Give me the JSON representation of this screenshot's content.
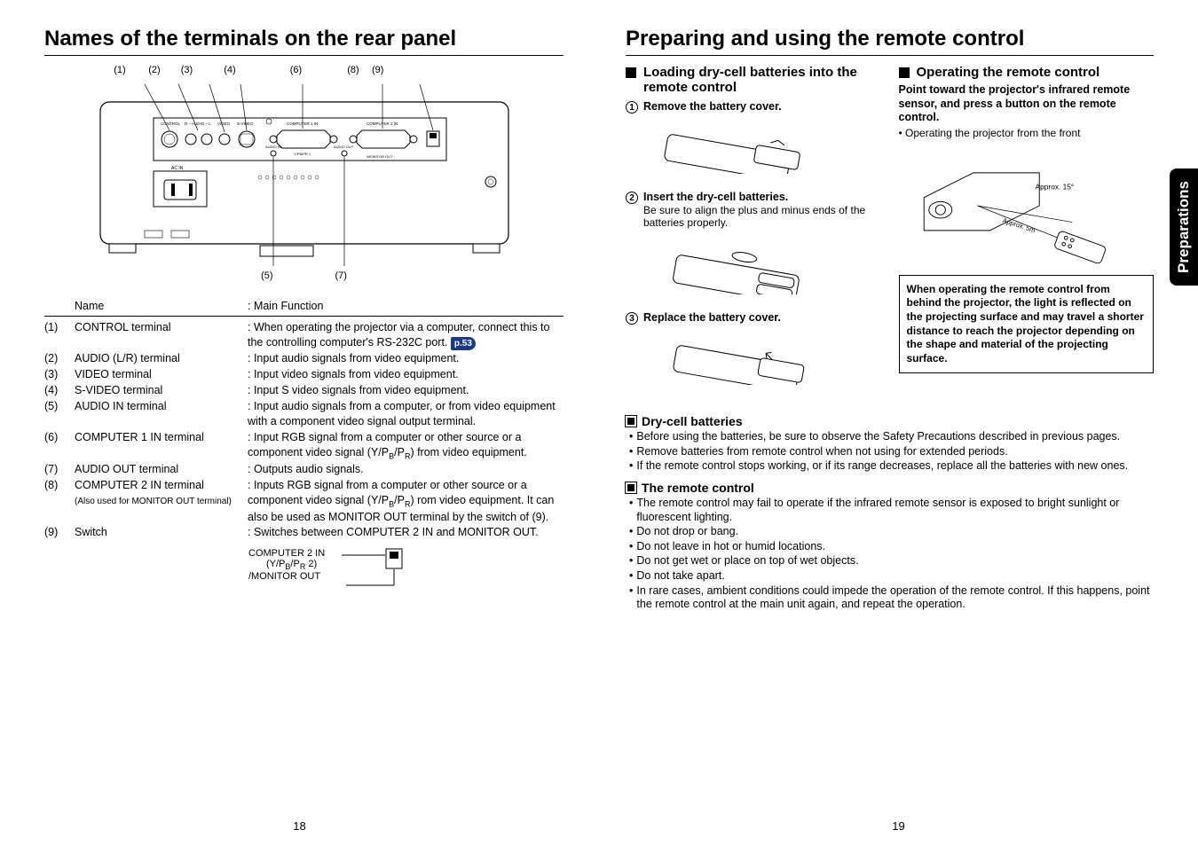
{
  "left": {
    "title": "Names of the terminals on the rear panel",
    "callouts_top": [
      "(1)",
      "(2)",
      "(3)",
      "(4)",
      "(6)",
      "(8)",
      "(9)"
    ],
    "callouts_bottom": [
      "(5)",
      "(7)"
    ],
    "table_head": {
      "name": "Name",
      "func": ": Main Function"
    },
    "rows": [
      {
        "n": "(1)",
        "name": "CONTROL terminal",
        "func": ": When operating the projector via a computer, connect this to the controlling computer's RS-232C port.",
        "pref": "p.53"
      },
      {
        "n": "(2)",
        "name": "AUDIO (L/R) terminal",
        "func": ": Input audio signals from video equipment."
      },
      {
        "n": "(3)",
        "name": "VIDEO terminal",
        "func": ": Input video signals from video equipment."
      },
      {
        "n": "(4)",
        "name": "S-VIDEO terminal",
        "func": ": Input S video signals from video equipment."
      },
      {
        "n": "(5)",
        "name": "AUDIO IN terminal",
        "func": ": Input audio signals from a computer, or from video equipment with a component video signal output terminal."
      },
      {
        "n": "(6)",
        "name": "COMPUTER 1 IN terminal",
        "func": ": Input RGB signal from a computer or other source or a component video signal (Y/PB/PR) from video equipment."
      },
      {
        "n": "(7)",
        "name": "AUDIO OUT terminal",
        "func": ": Outputs audio signals."
      },
      {
        "n": "(8)",
        "name": "COMPUTER 2 IN terminal",
        "sub": "(Also used for MONITOR OUT terminal)",
        "func": ": Inputs RGB signal from a computer or other source or a component video signal (Y/PB/PR) rom video equipment. It can also be used as MONITOR OUT terminal by the switch of (9)."
      },
      {
        "n": "(9)",
        "name": "Switch",
        "func": ": Switches between COMPUTER 2 IN and MONITOR OUT."
      }
    ],
    "switch_labels": {
      "top": "COMPUTER 2 IN",
      "mid": "(Y/PB/PR 2)",
      "bot": "/MONITOR OUT"
    },
    "page_num": "18"
  },
  "right": {
    "title": "Preparing and using the remote control",
    "load_head": "Loading dry-cell batteries into the remote control",
    "op_head": "Operating the remote control",
    "step1": "Remove the battery cover.",
    "step2": "Insert the dry-cell batteries.",
    "step2_body": "Be sure to align the plus and minus ends of the batteries properly.",
    "step3": "Replace the battery cover.",
    "op_text": "Point toward the projector's infrared remote sensor, and press a button on the remote control.",
    "op_bullet": "Operating the projector from the front",
    "approx15": "Approx. 15°",
    "note_box": "When operating the remote control from behind the projector, the light is reflected on the projecting surface and may travel a shorter distance to reach the projector depending on the shape and material of the projecting surface.",
    "tab": "Preparations",
    "notes1_head": "Dry-cell batteries",
    "notes1": [
      "Before using the batteries, be sure to observe the Safety Precautions described in previous pages.",
      "Remove batteries from remote control when not using for extended periods.",
      "If the remote control stops working, or if its range decreases, replace all the batteries with new ones."
    ],
    "notes2_head": "The remote control",
    "notes2": [
      "The remote control may fail to operate if the infrared remote sensor is exposed to bright sunlight or fluorescent lighting.",
      "Do not drop or bang.",
      "Do not leave in hot or humid locations.",
      "Do not get wet or place on top of wet objects.",
      "Do not take apart.",
      "In rare cases, ambient conditions could impede the operation of the remote control. If this happens, point the remote control at the main unit again, and repeat the operation."
    ],
    "page_num": "19"
  },
  "terminal_labels": {
    "control": "CONTROL",
    "audio_lr": "R – AUDIO – L",
    "video": "VIDEO",
    "svideo": "S-VIDEO",
    "comp1": "COMPUTER 1 IN",
    "comp2": "COMPUTER 2 IN",
    "audio_in": "AUDIO IN",
    "audio_out": "AUDIO OUT",
    "ypbpr1": "Y/PB/PR 1",
    "monitor": "/MONITOR OUT",
    "acin": "AC IN"
  }
}
